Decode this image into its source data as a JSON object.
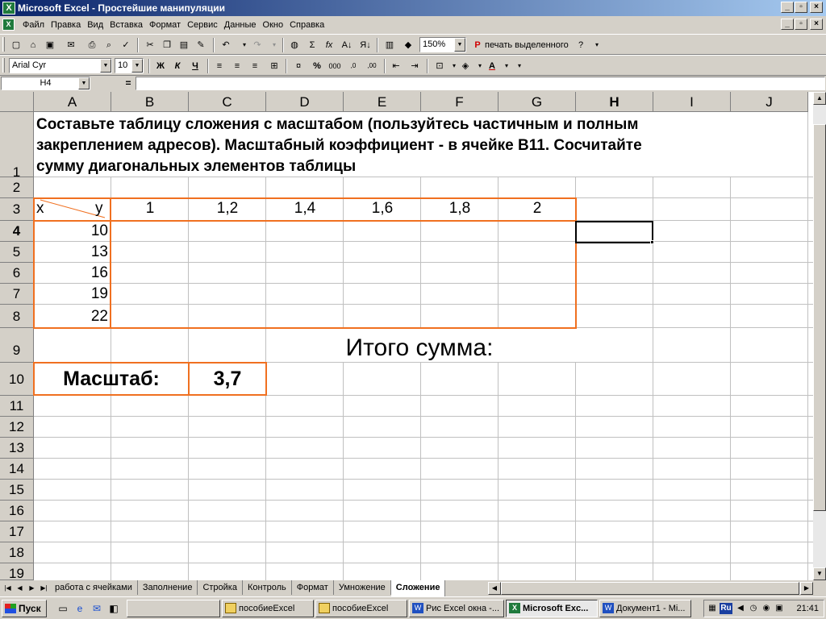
{
  "window": {
    "title": "Microsoft Excel - Простейшие манипуляции"
  },
  "menu": [
    "Файл",
    "Правка",
    "Вид",
    "Вставка",
    "Формат",
    "Сервис",
    "Данные",
    "Окно",
    "Справка"
  ],
  "toolbar": {
    "zoom": "150%",
    "print_selection_label": "печать выделенного",
    "font_name": "Arial Cyr",
    "font_size": "10",
    "bold_label": "Ж",
    "italic_label": "К",
    "underline_label": "Ч"
  },
  "formula_bar": {
    "name_box": "H4",
    "equals": "=",
    "content": ""
  },
  "columns": [
    "A",
    "B",
    "C",
    "D",
    "E",
    "F",
    "G",
    "H",
    "I",
    "J"
  ],
  "rows": [
    "1",
    "2",
    "3",
    "4",
    "5",
    "6",
    "7",
    "8",
    "9",
    "10",
    "11",
    "12",
    "13",
    "14",
    "15",
    "16",
    "17",
    "18",
    "19"
  ],
  "sheet": {
    "task_text": "Составьте таблицу сложения с масштабом (пользуйтесь частичным и полным закреплением адресов). Масштабный коэффициент - в ячейке В11. Сосчитайте сумму диагональных элементов таблицы",
    "corner_x": "x",
    "corner_y": "y",
    "y_values": [
      "1",
      "1,2",
      "1,4",
      "1,6",
      "1,8",
      "2"
    ],
    "x_values": [
      "10",
      "13",
      "16",
      "19",
      "22"
    ],
    "total_label": "Итого сумма:",
    "scale_label": "Масштаб:",
    "scale_value": "3,7"
  },
  "sheet_tabs": [
    "работа с ячейками",
    "Заполнение",
    "Стройка",
    "Контроль",
    "Формат",
    "Умножение",
    "Сложение"
  ],
  "taskbar": {
    "start_label": "Пуск",
    "tasks": [
      "пособиеExcel",
      "пособиеExcel",
      "Рис Excel окна -...",
      "Microsoft Exc...",
      "Документ1 - Mi..."
    ],
    "language": "Ru",
    "clock": "21:41"
  },
  "colors": {
    "title_bar": "#0a246a",
    "highlight_border": "#f07020",
    "chrome": "#d4d0c8"
  }
}
